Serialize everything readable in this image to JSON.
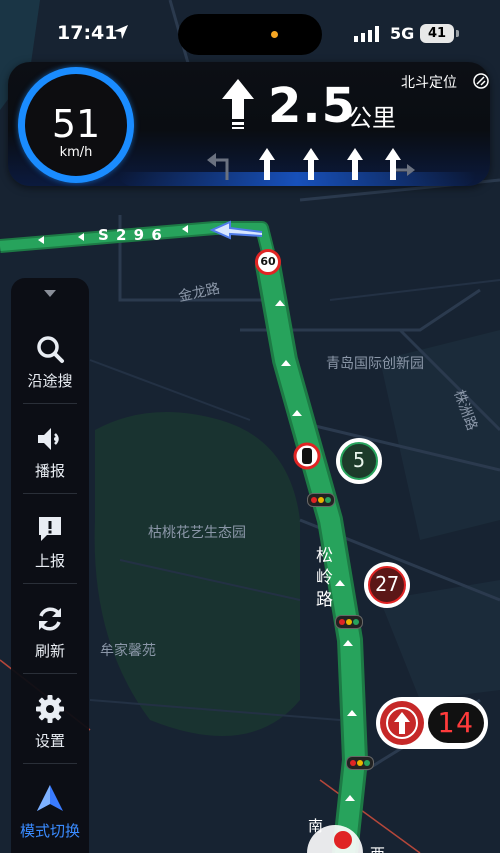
{
  "status_bar": {
    "time": "17:41",
    "network": "5G",
    "battery": "41"
  },
  "nav": {
    "speed_value": "51",
    "speed_unit": "km/h",
    "distance_value": "2.5",
    "distance_unit": "公里",
    "positioning": "北斗定位",
    "lanes": [
      "left-turn-dim",
      "straight",
      "straight",
      "straight",
      "straight-right"
    ]
  },
  "sidebar": {
    "items": [
      {
        "label": "沿途搜",
        "icon": "search-icon"
      },
      {
        "label": "播报",
        "icon": "speaker-icon"
      },
      {
        "label": "上报",
        "icon": "report-icon"
      },
      {
        "label": "刷新",
        "icon": "refresh-icon"
      },
      {
        "label": "设置",
        "icon": "gear-icon"
      },
      {
        "label": "模式切换",
        "icon": "mode-switch-icon"
      }
    ]
  },
  "map": {
    "road_s296": "S 2 9 6",
    "road_jinlong": "金龙路",
    "area_qingdao": "青岛国际创新园",
    "road_zhuzhou": "株洲路",
    "park": "枯桃花艺生态园",
    "road_songling": "松岭路",
    "area_nianjia": "牟家馨苑",
    "speed_limit": "60",
    "light_green": "5",
    "light_red": "27",
    "light_countdown": "14",
    "compass_s": "南",
    "compass_w": "西"
  },
  "colors": {
    "route": "#27a35c",
    "accent_blue": "#1a8cff",
    "red": "#e02424"
  }
}
